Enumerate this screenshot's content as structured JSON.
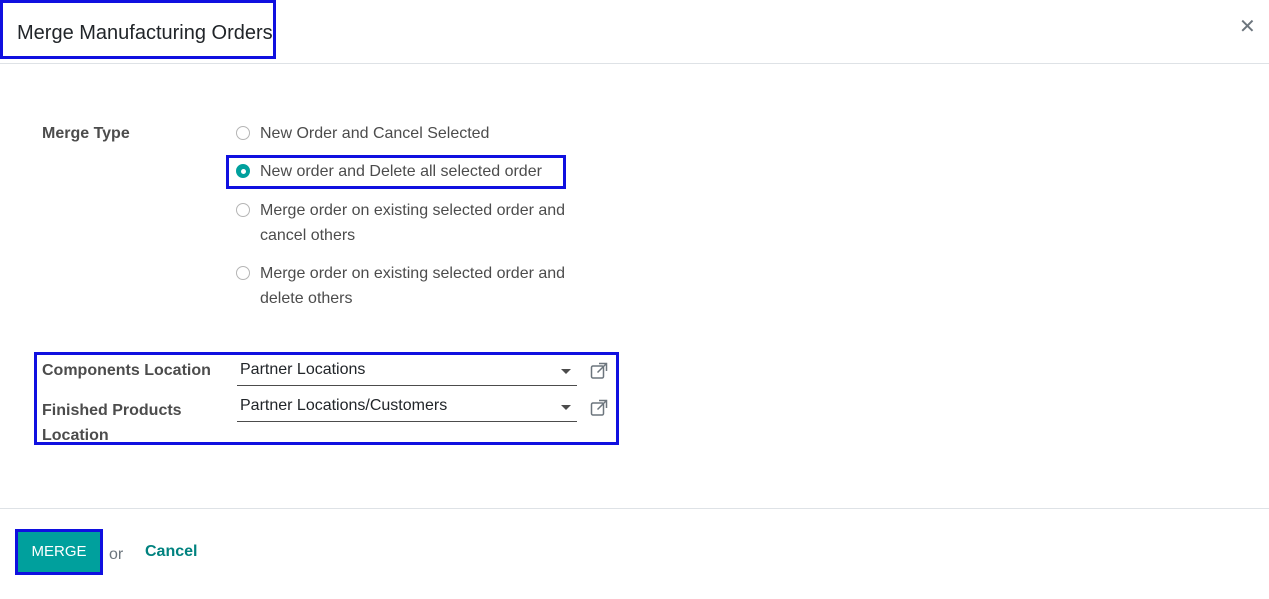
{
  "dialog": {
    "title": "Merge Manufacturing Orders",
    "close_icon": "close-icon"
  },
  "merge_type": {
    "label": "Merge Type",
    "selected_index": 1,
    "options": [
      {
        "label": "New Order and Cancel Selected",
        "checked": false
      },
      {
        "label": "New order and Delete all selected order",
        "checked": true
      },
      {
        "label": "Merge order on existing selected order and cancel others",
        "checked": false
      },
      {
        "label": "Merge order on existing selected order and delete others",
        "checked": false
      }
    ]
  },
  "locations": {
    "components": {
      "label": "Components Location",
      "value": "Partner Locations"
    },
    "finished": {
      "label": "Finished Products Location",
      "value": "Partner Locations/Customers"
    }
  },
  "footer": {
    "merge_label": "MERGE",
    "or_text": "or",
    "cancel_label": "Cancel"
  },
  "colors": {
    "accent": "#00a09d",
    "highlight": "#1010e0",
    "link": "#00827f"
  }
}
